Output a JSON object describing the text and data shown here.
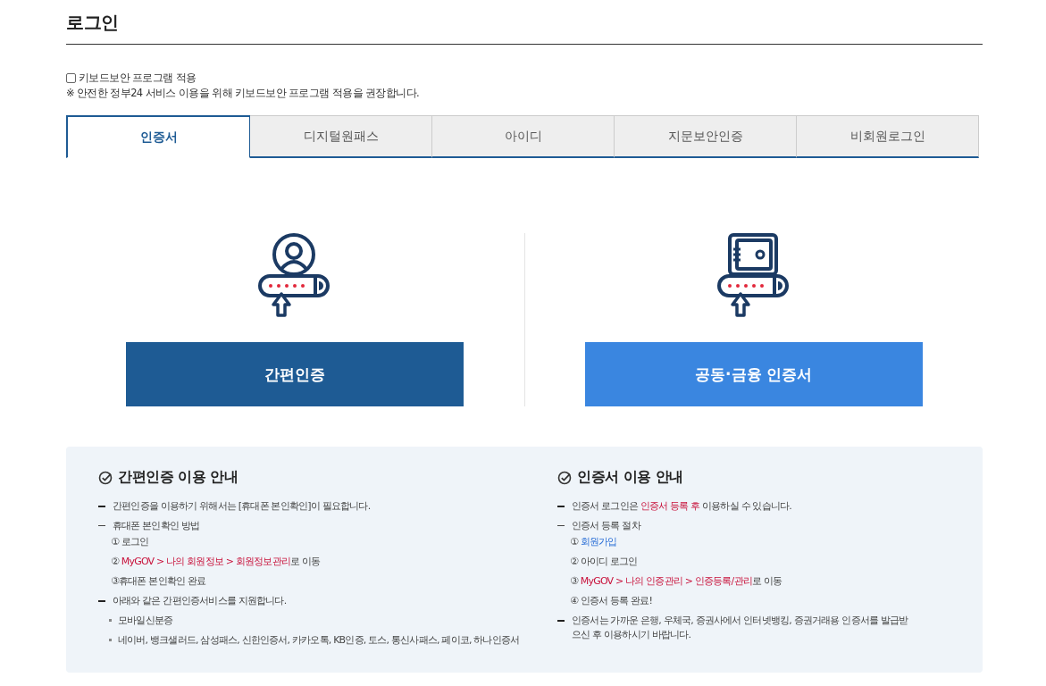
{
  "title": "로그인",
  "keyboard_security": {
    "label": "키보드보안 프로그램 적용",
    "checked": false,
    "note": "※ 안전한 정부24 서비스 이용을 위해 키보드보안 프로그램 적용을 권장합니다."
  },
  "tabs": [
    {
      "label": "인증서",
      "selected": true
    },
    {
      "label": "디지털원패스",
      "selected": false
    },
    {
      "label": "아이디",
      "selected": false
    },
    {
      "label": "지문보안인증",
      "selected": false
    },
    {
      "label": "비회원로그인",
      "selected": false
    }
  ],
  "login_options": [
    {
      "kind": "person",
      "button": "간편인증",
      "color": "#1e5b94"
    },
    {
      "kind": "safe",
      "button": "공동·금융 인증서",
      "color": "#3a86e0"
    }
  ],
  "guides": [
    {
      "title": "간편인증 이용 안내",
      "items": [
        {
          "kind": "bullet",
          "parts": [
            {
              "text": "간편인증을 이용하기 위해서는 [휴대폰 본인확인]이 필요합니다.",
              "kind": "plain"
            }
          ]
        },
        {
          "kind": "dash",
          "parts": [
            {
              "text": "휴대폰 본인확인 방법",
              "kind": "plain"
            }
          ]
        },
        {
          "kind": "step",
          "parts": [
            {
              "text": "① 로그인",
              "kind": "plain"
            }
          ]
        },
        {
          "kind": "step",
          "parts": [
            {
              "text": "② ",
              "kind": "plain"
            },
            {
              "text": "MyGOV > 나의 회원정보 > 회원정보관리",
              "kind": "red"
            },
            {
              "text": "로 이동",
              "kind": "plain"
            }
          ]
        },
        {
          "kind": "step",
          "parts": [
            {
              "text": "③휴대폰 본인확인 완료",
              "kind": "plain"
            }
          ]
        },
        {
          "kind": "bullet",
          "parts": [
            {
              "text": "아래와 같은 간편인증서비스를 지원합니다.",
              "kind": "plain"
            }
          ]
        },
        {
          "kind": "dot",
          "parts": [
            {
              "text": "모바일신분증",
              "kind": "plain"
            }
          ]
        },
        {
          "kind": "dot",
          "parts": [
            {
              "text": "네이버, 뱅크샐러드, 삼성패스, 신한인증서, 카카오톡, KB인증, 토스, 통신사패스, 페이코, 하나인증서",
              "kind": "plain"
            }
          ]
        }
      ]
    },
    {
      "title": "인증서 이용 안내",
      "items": [
        {
          "kind": "bullet",
          "parts": [
            {
              "text": "인증서 로그인은 ",
              "kind": "plain"
            },
            {
              "text": "인증서 등록 후",
              "kind": "red"
            },
            {
              "text": " 이용하실 수 있습니다.",
              "kind": "plain"
            }
          ]
        },
        {
          "kind": "dash",
          "parts": [
            {
              "text": "인증서 등록 절차",
              "kind": "plain"
            }
          ]
        },
        {
          "kind": "step",
          "parts": [
            {
              "text": "① ",
              "kind": "plain"
            },
            {
              "text": "회원가입",
              "kind": "link"
            }
          ]
        },
        {
          "kind": "step",
          "parts": [
            {
              "text": "② 아이디 로그인",
              "kind": "plain"
            }
          ]
        },
        {
          "kind": "step",
          "parts": [
            {
              "text": "③ ",
              "kind": "plain"
            },
            {
              "text": "MyGOV > 나의 인증관리 > 인증등록/관리",
              "kind": "red"
            },
            {
              "text": "로 이동",
              "kind": "plain"
            }
          ]
        },
        {
          "kind": "step",
          "parts": [
            {
              "text": "④ 인증서 등록 완료!",
              "kind": "plain"
            }
          ]
        },
        {
          "kind": "bullet",
          "parts": [
            {
              "text": "인증서는 가까운 은행, 우체국, 증권사에서 인터넷뱅킹, 증권거래용 인증서를 발급받으신 후 이용하시기 바랍니다.",
              "kind": "plain"
            }
          ]
        }
      ]
    }
  ]
}
